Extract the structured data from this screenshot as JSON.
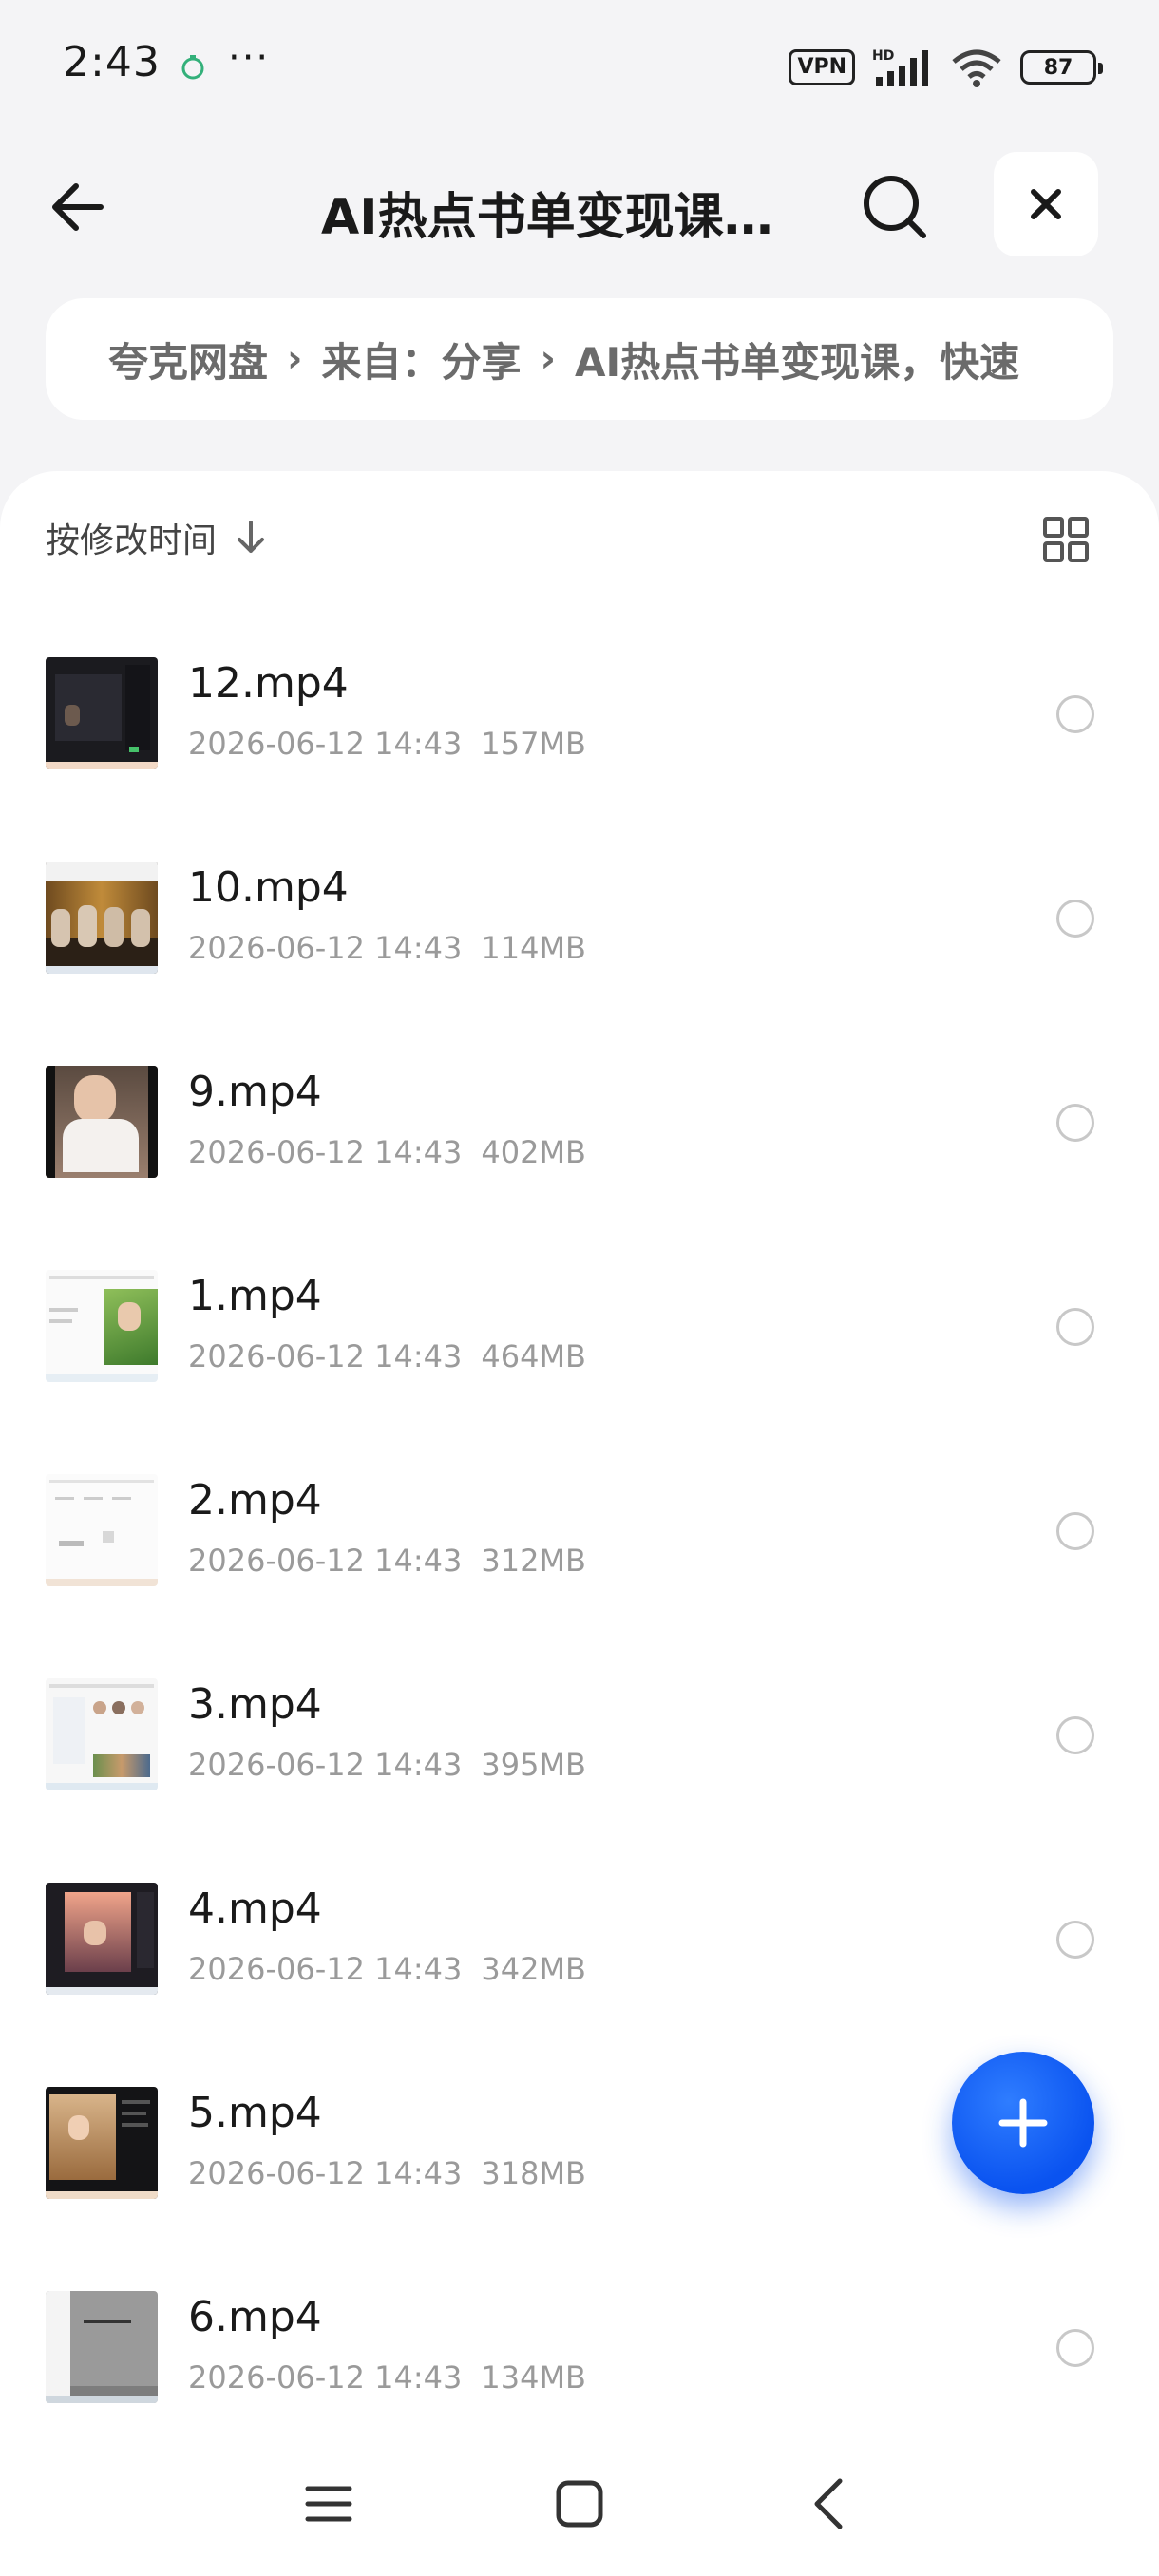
{
  "status_bar": {
    "time": "2:43",
    "dots": "···",
    "vpn": "VPN",
    "network": "HD",
    "battery": "87"
  },
  "header": {
    "title": "AI热点书单变现课，..."
  },
  "breadcrumb": {
    "items": [
      "夸克网盘",
      "来自：分享",
      "AI热点书单变现课，快速"
    ]
  },
  "toolbar": {
    "sort_label": "按修改时间"
  },
  "files": [
    {
      "name": "12.mp4",
      "date": "2026-06-12 14:43",
      "size": "157MB"
    },
    {
      "name": "10.mp4",
      "date": "2026-06-12 14:43",
      "size": "114MB"
    },
    {
      "name": "9.mp4",
      "date": "2026-06-12 14:43",
      "size": "402MB"
    },
    {
      "name": "1.mp4",
      "date": "2026-06-12 14:43",
      "size": "464MB"
    },
    {
      "name": "2.mp4",
      "date": "2026-06-12 14:43",
      "size": "312MB"
    },
    {
      "name": "3.mp4",
      "date": "2026-06-12 14:43",
      "size": "395MB"
    },
    {
      "name": "4.mp4",
      "date": "2026-06-12 14:43",
      "size": "342MB"
    },
    {
      "name": "5.mp4",
      "date": "2026-06-12 14:43",
      "size": "318MB"
    },
    {
      "name": "6.mp4",
      "date": "2026-06-12 14:43",
      "size": "134MB"
    }
  ],
  "colors": {
    "accent": "#0a53f0",
    "background": "#f4f4f6",
    "meta_text": "#9a9a9a"
  },
  "icons": {
    "back": "arrow-left-icon",
    "search": "search-icon",
    "close": "close-icon",
    "sort": "arrow-down-icon",
    "view": "grid-view-icon",
    "fab": "plus-icon"
  }
}
